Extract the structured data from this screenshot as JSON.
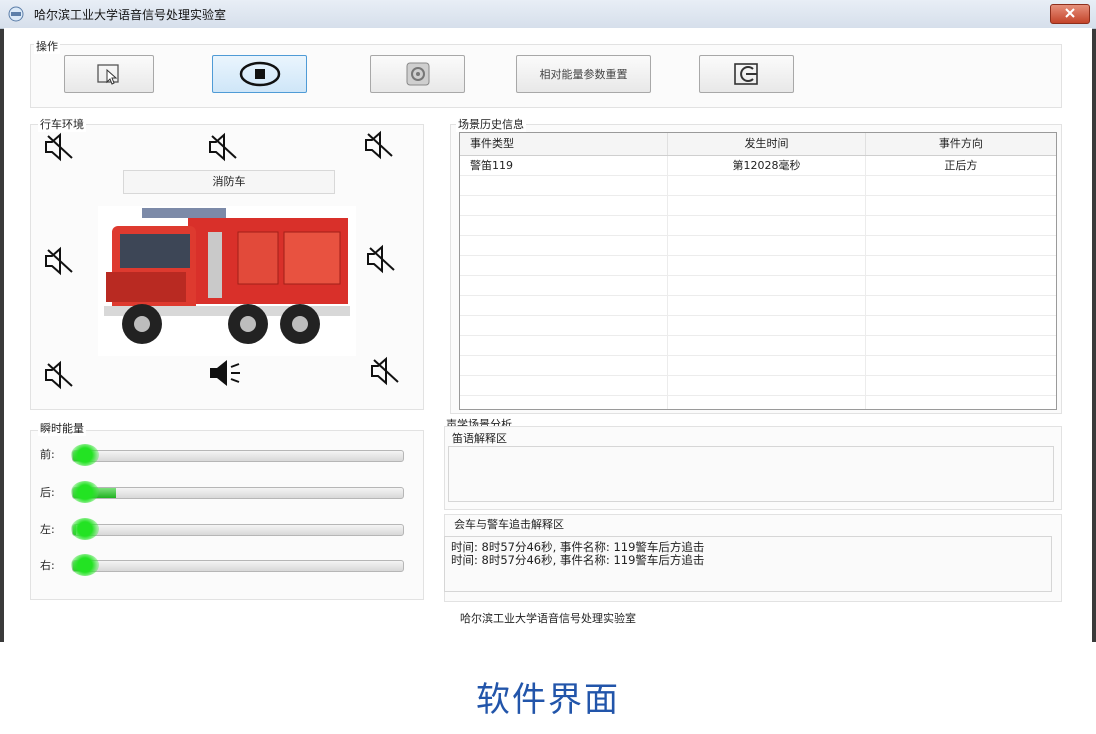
{
  "window": {
    "title": "哈尔滨工业大学语音信号处理实验室"
  },
  "toolbar": {
    "group_label": "操作",
    "reset_label": "相对能量参数重置",
    "buttons": [
      {
        "name": "select-button",
        "icon": "cursor-icon"
      },
      {
        "name": "stop-button",
        "icon": "stop-icon",
        "active": true
      },
      {
        "name": "settings-button",
        "icon": "gear-icon"
      },
      {
        "name": "reset-energy-button",
        "icon": ""
      },
      {
        "name": "exit-button",
        "icon": "exit-icon"
      }
    ]
  },
  "environment": {
    "group_label": "行车环境",
    "vehicle_label": "消防车",
    "speakers": [
      {
        "position": "front-left",
        "state": "muted"
      },
      {
        "position": "front-center",
        "state": "muted"
      },
      {
        "position": "front-right",
        "state": "muted"
      },
      {
        "position": "left",
        "state": "muted"
      },
      {
        "position": "right",
        "state": "muted"
      },
      {
        "position": "rear-left",
        "state": "muted"
      },
      {
        "position": "rear-center",
        "state": "active"
      },
      {
        "position": "rear-right",
        "state": "muted"
      }
    ]
  },
  "history": {
    "group_label": "场景历史信息",
    "columns": [
      "事件类型",
      "发生时间",
      "事件方向"
    ],
    "rows": [
      [
        "警笛119",
        "第12028毫秒",
        "正后方"
      ]
    ]
  },
  "energy": {
    "group_label": "瞬时能量",
    "channels": [
      {
        "label": "前:",
        "level": 0.03
      },
      {
        "label": "后:",
        "level": 0.13
      },
      {
        "label": "左:",
        "level": 0.01
      },
      {
        "label": "右:",
        "level": 0.04
      }
    ],
    "accent": "#22dd22"
  },
  "analysis": {
    "group_label": "声学场景分析",
    "siren_label": "笛语解释区",
    "chase_label": "会车与警车追击解释区",
    "log": [
      "时间: 8时57分46秒, 事件名称: 119警车后方追击",
      "时间: 8时57分46秒, 事件名称: 119警车后方追击"
    ]
  },
  "footer": "哈尔滨工业大学语音信号处理实验室",
  "caption": "软件界面"
}
